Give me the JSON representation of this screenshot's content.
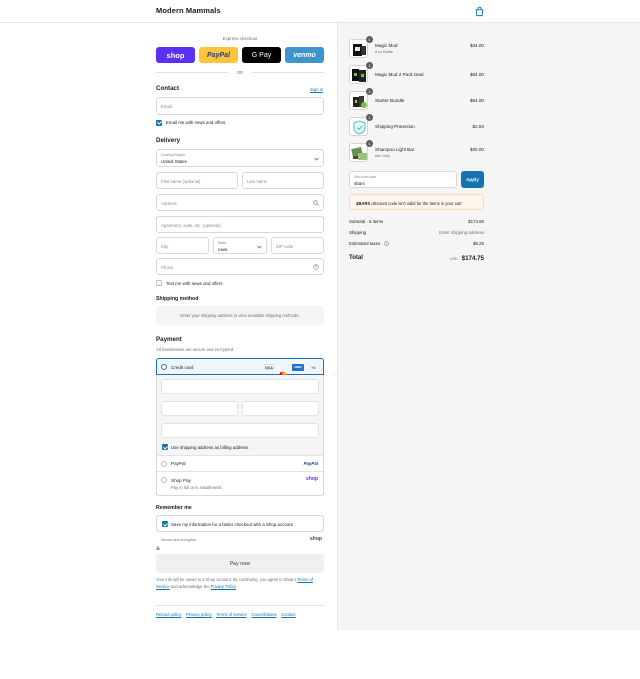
{
  "header": {
    "store_name": "Modern Mammals",
    "cart_icon": "shopping-bag-icon"
  },
  "express": {
    "title": "Express checkout",
    "buttons": [
      {
        "label": "shop",
        "color": "#5a31f4"
      },
      {
        "label": "PayPal",
        "color": "#ffc439"
      },
      {
        "label": "G Pay",
        "color": "#000000"
      },
      {
        "label": "venmo",
        "color": "#3d95ce"
      }
    ],
    "or_label": "OR"
  },
  "contact": {
    "title": "Contact",
    "sign_in": "Sign in",
    "email_placeholder": "Email",
    "email_news_label": "Email me with news and offers",
    "email_news_checked": true
  },
  "delivery": {
    "title": "Delivery",
    "country_label": "Country/Region",
    "country_value": "United States",
    "first_name_placeholder": "First name (optional)",
    "last_name_placeholder": "Last name",
    "address_placeholder": "Address",
    "apartment_placeholder": "Apartment, suite, etc. (optional)",
    "city_placeholder": "City",
    "state_label": "State",
    "state_value": "Iowa",
    "zip_placeholder": "ZIP code",
    "phone_placeholder": "Phone",
    "text_news_label": "Text me with news and offers",
    "text_news_checked": false
  },
  "shipping": {
    "title": "Shipping method",
    "message": "Enter your shipping address to view available shipping methods."
  },
  "payment": {
    "title": "Payment",
    "subtitle": "All transactions are secure and encrypted.",
    "credit_card_label": "Credit card",
    "card_brands": [
      "VISA",
      "MC",
      "AMEX"
    ],
    "more_cards": "+4",
    "billing_same_label": "Use shipping address as billing address",
    "billing_same_checked": true,
    "paypal_label": "PayPal",
    "paypal_logo": "PayPal",
    "shoppay_label": "Shop Pay",
    "shoppay_sub": "Pay in full or in installments",
    "shoppay_logo": "shop"
  },
  "remember": {
    "title": "Remember me",
    "save_label": "Save my information for a faster checkout with a Shop account",
    "save_checked": true,
    "secure_label": "Secure and encrypted",
    "shop_logo": "shop"
  },
  "pay_now": "Pay now",
  "legal": {
    "text1": "Your info will be saved to a Shop account. By continuing, you agree to Shop's",
    "tos": "Terms of Service",
    "text2": "and acknowledge the",
    "privacy": "Privacy Policy",
    "end": "."
  },
  "footer_links": [
    "Refund policy",
    "Privacy policy",
    "Terms of service",
    "Cancellations",
    "Contact"
  ],
  "cart": {
    "items": [
      {
        "name": "Magic Mud",
        "variant": "8 oz Bottle",
        "qty": "1",
        "price": "$34.00"
      },
      {
        "name": "Magic Mud 2 Pack Deal",
        "variant": "",
        "qty": "1",
        "price": "$54.00"
      },
      {
        "name": "Starter Bundle",
        "variant": "",
        "qty": "1",
        "price": "$54.00"
      },
      {
        "name": "Shipping Protection",
        "variant": "",
        "qty": "1",
        "price": "$2.50"
      },
      {
        "name": "Shampoo Light Bar",
        "variant": "Bar Only",
        "qty": "1",
        "price": "$30.00"
      }
    ],
    "discount_label": "Discount code",
    "discount_value": "4bars",
    "apply_label": "Apply",
    "discount_error_code": "4BARS",
    "discount_error_text": "discount code isn't valid for the items in your cart",
    "subtotal_label": "Subtotal · 5 items",
    "subtotal_value": "$174.50",
    "shipping_label": "Shipping",
    "shipping_value": "Enter shipping address",
    "taxes_label": "Estimated taxes",
    "taxes_value": "$6.25",
    "total_label": "Total",
    "currency": "USD",
    "total_value": "$174.75"
  }
}
